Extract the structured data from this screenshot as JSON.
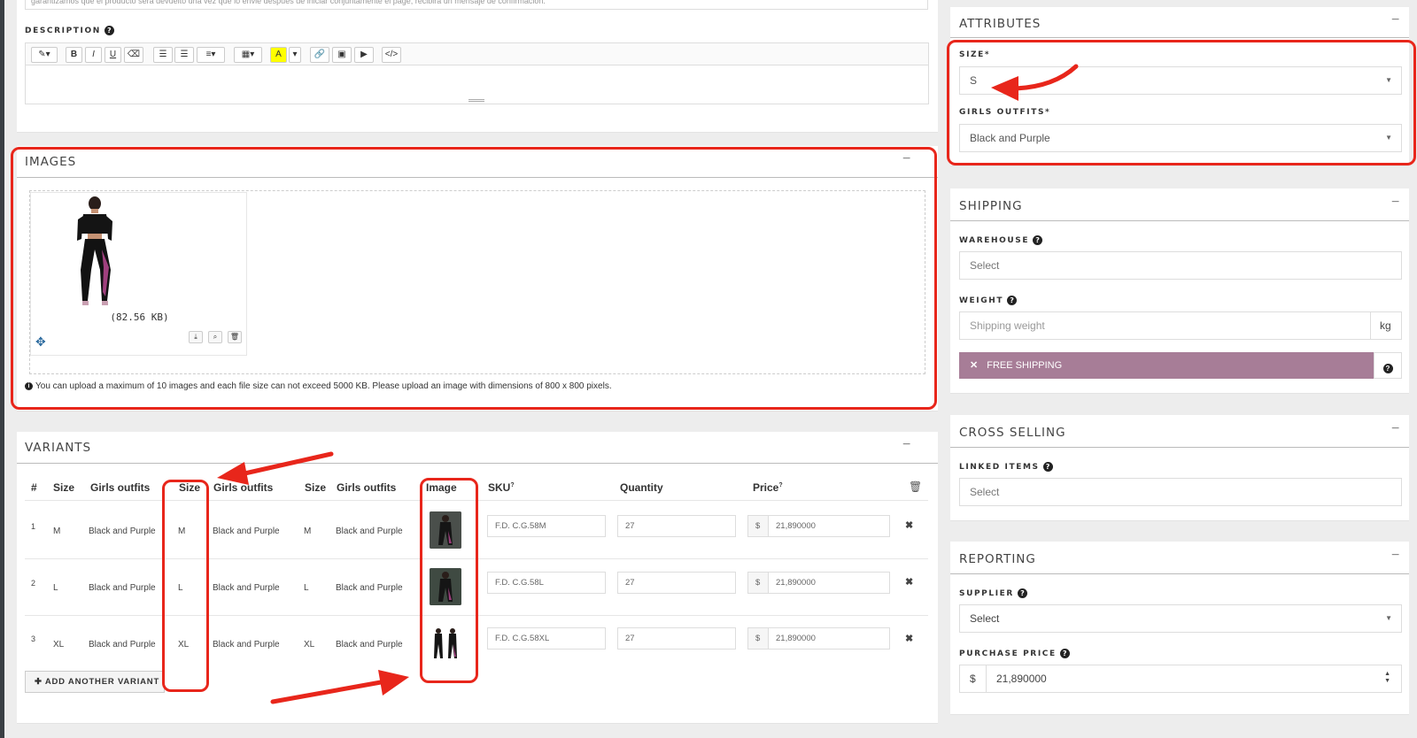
{
  "description": {
    "label": "DESCRIPTION",
    "top_text": "garantizamos que el producto sera devuelto una vez que lo envie despues de iniciar conjuntamente el page, recibira un mensaje de confirmacion."
  },
  "images": {
    "title": "IMAGES",
    "collapse": "−",
    "file_size": "(82.56 KB)",
    "note": "You can upload a maximum of 10 images and each file size can not exceed 5000 KB. Please upload an image with dimensions of 800 x 800 pixels."
  },
  "variants": {
    "title": "VARIANTS",
    "collapse": "−",
    "headers": [
      "#",
      "Size",
      "Girls outfits",
      "Size",
      "Girls outfits",
      "Size",
      "Girls outfits",
      "Image",
      "SKU",
      "Quantity",
      "Price"
    ],
    "sup": "?",
    "rows": [
      {
        "n": "1",
        "size1": "M",
        "out1": "Black and Purple",
        "size2": "M",
        "out2": "Black and Purple",
        "size3": "M",
        "out3": "Black and Purple",
        "sku": "F.D. C.G.58M",
        "qty": "27",
        "cur": "$",
        "price": "21,890000"
      },
      {
        "n": "2",
        "size1": "L",
        "out1": "Black and Purple",
        "size2": "L",
        "out2": "Black and Purple",
        "size3": "L",
        "out3": "Black and Purple",
        "sku": "F.D. C.G.58L",
        "qty": "27",
        "cur": "$",
        "price": "21,890000"
      },
      {
        "n": "3",
        "size1": "XL",
        "out1": "Black and Purple",
        "size2": "XL",
        "out2": "Black and Purple",
        "size3": "XL",
        "out3": "Black and Purple",
        "sku": "F.D. C.G.58XL",
        "qty": "27",
        "cur": "$",
        "price": "21,890000"
      }
    ],
    "add_button": "ADD ANOTHER VARIANT"
  },
  "attributes": {
    "title": "ATTRIBUTES",
    "size_label": "SIZE*",
    "size_value": "S",
    "outfits_label": "GIRLS OUTFITS*",
    "outfits_value": "Black and Purple"
  },
  "shipping": {
    "title": "SHIPPING",
    "warehouse_label": "WAREHOUSE",
    "warehouse_placeholder": "Select",
    "weight_label": "WEIGHT",
    "weight_placeholder": "Shipping weight",
    "weight_unit": "kg",
    "free_shipping": "FREE SHIPPING"
  },
  "cross_selling": {
    "title": "CROSS SELLING",
    "linked_label": "LINKED ITEMS",
    "linked_placeholder": "Select"
  },
  "reporting": {
    "title": "REPORTING",
    "supplier_label": "SUPPLIER",
    "supplier_value": "Select",
    "purchase_label": "PURCHASE PRICE",
    "currency": "$",
    "purchase_value": "21,890000"
  },
  "colors": {
    "annotation_red": "#e8261b",
    "free_shipping_bg": "#a77d97"
  }
}
